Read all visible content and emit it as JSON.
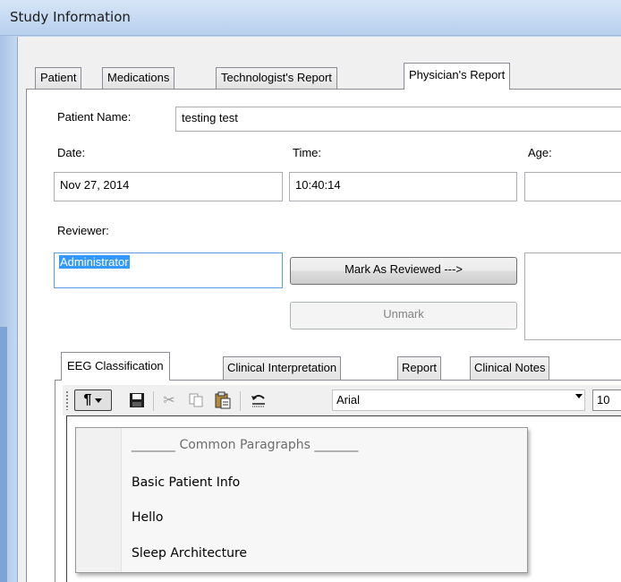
{
  "window": {
    "title": "Study Information"
  },
  "tabs": [
    "Patient",
    "Medications",
    "Technologist's Report",
    "Physician's Report"
  ],
  "form": {
    "patient_name_label": "Patient Name:",
    "patient_name_value": "testing test",
    "date_label": "Date:",
    "date_value": "Nov 27, 2014",
    "time_label": "Time:",
    "time_value": "10:40:14",
    "age_label": "Age:",
    "age_value": "",
    "reviewer_label": "Reviewer:",
    "reviewer_value": "Administrator"
  },
  "buttons": {
    "mark_reviewed": "Mark As Reviewed --->",
    "unmark": "Unmark"
  },
  "inner_tabs": [
    "EEG Classification",
    "Clinical Interpretation",
    "Report",
    "Clinical Notes"
  ],
  "toolbar": {
    "icons": [
      "paragraph-icon",
      "save-icon",
      "cut-icon",
      "copy-icon",
      "paste-icon",
      "undo-icon"
    ],
    "paragraph_glyph": "¶",
    "font_name": "Arial",
    "font_size": "10"
  },
  "menu": {
    "header": "_______ Common Paragraphs _______",
    "items": [
      "Basic Patient Info",
      "Hello",
      "Sleep Architecture"
    ]
  }
}
